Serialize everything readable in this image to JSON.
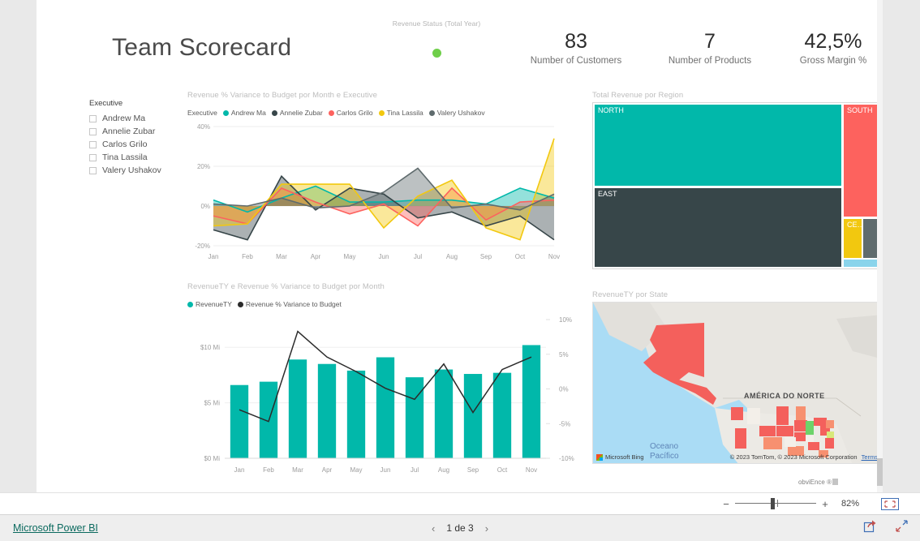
{
  "report": {
    "title": "Team Scorecard",
    "status_caption": "Revenue Status (Total Year)",
    "status_color": "#6fcf4a",
    "kpis": [
      {
        "value": "83",
        "label": "Number of Customers"
      },
      {
        "value": "7",
        "label": "Number of Products"
      },
      {
        "value": "42,5%",
        "label": "Gross Margin %"
      }
    ],
    "watermark": "obviEnce ®"
  },
  "slicer": {
    "title": "Executive",
    "items": [
      {
        "label": "Andrew Ma",
        "checked": false
      },
      {
        "label": "Annelie Zubar",
        "checked": false
      },
      {
        "label": "Carlos Grilo",
        "checked": false
      },
      {
        "label": "Tina Lassila",
        "checked": false
      },
      {
        "label": "Valery Ushakov",
        "checked": false
      }
    ]
  },
  "chart_data": [
    {
      "id": "variance_by_executive",
      "type": "area",
      "title": "Revenue % Variance to Budget por Month e Executive",
      "legend_title": "Executive",
      "legend_position": "top",
      "xlabel": "",
      "ylabel": "",
      "categories": [
        "Jan",
        "Feb",
        "Mar",
        "Apr",
        "May",
        "Jun",
        "Jul",
        "Aug",
        "Sep",
        "Oct",
        "Nov"
      ],
      "ytick_labels": [
        "40%",
        "20%",
        "0%",
        "-20%"
      ],
      "ylim": [
        -20,
        40
      ],
      "grid": true,
      "series": [
        {
          "name": "Andrew Ma",
          "color": "#01b8aa",
          "values": [
            3,
            -3,
            4,
            10,
            2,
            2,
            3,
            3,
            1,
            9,
            4
          ]
        },
        {
          "name": "Annelie Zubar",
          "color": "#374649",
          "values": [
            -12,
            -17,
            15,
            -2,
            9,
            6,
            -6,
            -3,
            -10,
            -5,
            -17
          ]
        },
        {
          "name": "Carlos Grilo",
          "color": "#fd625e",
          "values": [
            -5,
            -9,
            9,
            2,
            -4,
            1,
            -10,
            9,
            -7,
            2,
            3
          ]
        },
        {
          "name": "Tina Lassila",
          "color": "#f2c80f",
          "values": [
            -10,
            -9,
            11,
            11,
            11,
            -11,
            5,
            13,
            -11,
            -17,
            34
          ]
        },
        {
          "name": "Valery Ushakov",
          "color": "#5f6b6d",
          "values": [
            1,
            0,
            4,
            -1,
            0,
            7,
            19,
            -1,
            1,
            -2,
            6
          ]
        }
      ]
    },
    {
      "id": "revenue_by_region",
      "type": "treemap",
      "title": "Total Revenue por Region",
      "slices": [
        {
          "label": "NORTH",
          "color": "#01b8aa",
          "visible_label": true
        },
        {
          "label": "EAST",
          "color": "#374649",
          "visible_label": true
        },
        {
          "label": "SOUTH",
          "color": "#fd625e",
          "visible_label": true
        },
        {
          "label": "CE…",
          "color": "#f2c80f",
          "visible_label": true
        },
        {
          "label": "",
          "color": "#5f6b6d",
          "visible_label": false
        },
        {
          "label": "",
          "color": "#8ad4eb",
          "visible_label": false
        }
      ]
    },
    {
      "id": "revenue_and_variance_by_month",
      "type": "bar",
      "title": "RevenueTY e Revenue % Variance to Budget por Month",
      "legend_position": "top",
      "categories": [
        "Jan",
        "Feb",
        "Mar",
        "Apr",
        "May",
        "Jun",
        "Jul",
        "Aug",
        "Sep",
        "Oct",
        "Nov"
      ],
      "left_axis_ticks": [
        "$10 Mi",
        "$5 Mi",
        "$0 Mi"
      ],
      "right_axis_ticks": [
        "10%",
        "5%",
        "0%",
        "-5%",
        "-10%"
      ],
      "ylim": [
        0,
        12.5
      ],
      "y2lim": [
        -10,
        10
      ],
      "grid": true,
      "series": [
        {
          "name": "RevenueTY",
          "color": "#01b8aa",
          "type": "bar",
          "values": [
            6.6,
            6.9,
            8.9,
            8.5,
            7.9,
            9.1,
            7.3,
            8.0,
            7.6,
            7.7,
            10.2
          ]
        },
        {
          "name": "Revenue % Variance to Budget",
          "color": "#2b2b2b",
          "type": "line",
          "values": [
            -3.0,
            -4.7,
            8.3,
            4.6,
            2.5,
            0.1,
            -1.5,
            3.6,
            -3.4,
            2.8,
            4.6
          ]
        }
      ]
    },
    {
      "id": "revenue_by_state",
      "type": "map",
      "title": "RevenueTY por State",
      "region_label": "AMÉRICA DO NORTE",
      "ocean_labels": [
        "Oceano",
        "Pacífico"
      ],
      "attribution_provider": "Microsoft Bing",
      "attribution_copyright": "© 2023 TomTom, © 2023 Microsoft Corporation",
      "attribution_terms": "Terms"
    }
  ],
  "zoombar": {
    "minus": "−",
    "plus": "+",
    "percent": "82%",
    "fit_icon": "fit-to-page-icon"
  },
  "footer": {
    "brand": "Microsoft Power BI",
    "page_prev": "‹",
    "page_text": "1 de 3",
    "page_next": "›",
    "share_icon": "share-icon",
    "fullscreen_icon": "fullscreen-icon"
  }
}
